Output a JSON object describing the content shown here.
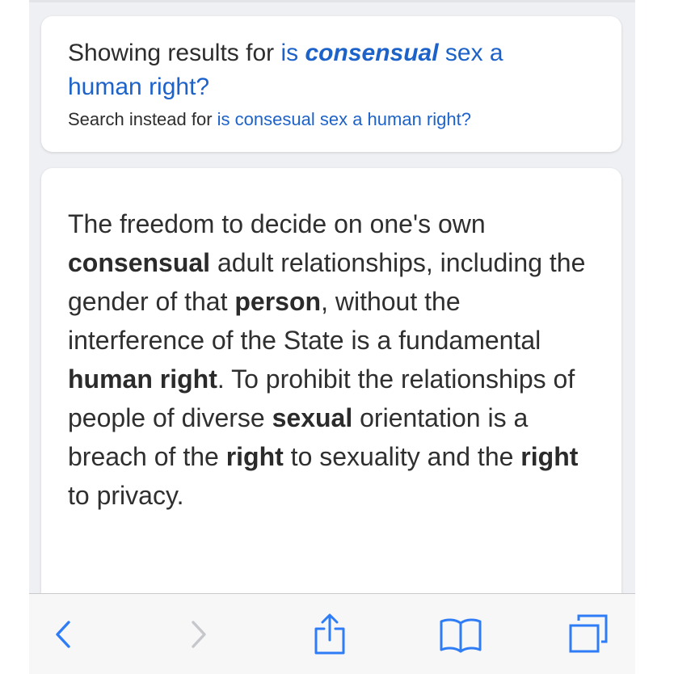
{
  "correction": {
    "prefix": "Showing results for",
    "query_pre": "is",
    "query_bold": "consensual",
    "query_post_1": "sex a",
    "query_post_2": "human right?",
    "instead_prefix": "Search instead for",
    "instead_query": "is consesual sex a human right?"
  },
  "answer": {
    "segments": [
      {
        "t": "The freedom to decide on one's own ",
        "b": false
      },
      {
        "t": "consensual",
        "b": true
      },
      {
        "t": " adult relationships, including the gender of that ",
        "b": false
      },
      {
        "t": "person",
        "b": true
      },
      {
        "t": ", without the interference of the State is a fundamental ",
        "b": false
      },
      {
        "t": "human right",
        "b": true
      },
      {
        "t": ". To prohibit the relationships of people of diverse ",
        "b": false
      },
      {
        "t": "sexual",
        "b": true
      },
      {
        "t": " orientation is a breach of the ",
        "b": false
      },
      {
        "t": "right",
        "b": true
      },
      {
        "t": " to sexuality and the ",
        "b": false
      },
      {
        "t": "right",
        "b": true
      },
      {
        "t": " to privacy.",
        "b": false
      }
    ]
  },
  "toolbar": {
    "items": [
      {
        "name": "back-button",
        "icon": "chevron-left-icon",
        "enabled": true
      },
      {
        "name": "forward-button",
        "icon": "chevron-right-icon",
        "enabled": false
      },
      {
        "name": "share-button",
        "icon": "share-icon",
        "enabled": true
      },
      {
        "name": "bookmarks-button",
        "icon": "book-icon",
        "enabled": true
      },
      {
        "name": "tabs-button",
        "icon": "tabs-icon",
        "enabled": true
      }
    ]
  },
  "colors": {
    "accent": "#1d62c9",
    "toolbar_icon": "#2f7df6",
    "toolbar_icon_disabled": "#c6c7cc"
  }
}
